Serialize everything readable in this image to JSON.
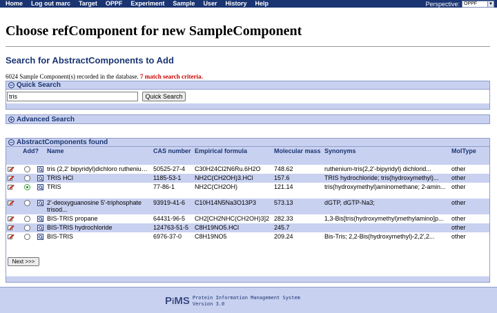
{
  "nav": {
    "items": [
      "Home",
      "Log out marc",
      "Target",
      "OPPF",
      "Experiment",
      "Sample",
      "User",
      "History",
      "Help"
    ],
    "perspective_label": "Perspective:",
    "perspective_value": "OPPF"
  },
  "page_title": "Choose refComponent for new SampleComponent",
  "section_heading": "Search for AbstractComponents to Add",
  "record_count": {
    "text": "6024 Sample Component(s) recorded in the database.",
    "criteria": "7 match search criteria."
  },
  "quick_search": {
    "title": "Quick Search",
    "value": "tris",
    "button_label": "Quick Search"
  },
  "advanced_search": {
    "title": "Advanced Search"
  },
  "results": {
    "title": "AbstractComponents found",
    "columns": [
      "Add?",
      "Name",
      "CAS number",
      "Empirical formula",
      "Molecular mass",
      "Synonyms",
      "MolType"
    ],
    "rows": [
      {
        "name": "tris (2,2' bipyridyl)dichloro ruthenium(...",
        "cas": "50525-27-4",
        "formula": "C30H24Cl2N6Ru.6H2O",
        "mass": "748.62",
        "synonyms": "ruthenium-tris(2,2'-bipyridyl) dichlorid...",
        "moltype": "other",
        "checked": false
      },
      {
        "name": "TRIS HCl",
        "cas": "1185-53-1",
        "formula": "NH2C(CH2OH)3.HCl",
        "mass": "157.6",
        "synonyms": "TRIS hydrochloride; tris(hydroxymethyl)...",
        "moltype": "other",
        "checked": false
      },
      {
        "name": "TRIS",
        "cas": "77-86-1",
        "formula": "NH2C(CH2OH)",
        "mass": "121.14",
        "synonyms": "tris(hydroxymethyl)aminomethane; 2-amin...",
        "moltype": "other",
        "checked": true
      },
      {
        "name": "2'-deoxyguanosine 5'-triphosphate trisod...",
        "cas": "93919-41-6",
        "formula": "C10H14N5Na3O13P3",
        "mass": "573.13",
        "synonyms": "dGTP, dGTP-Na3;",
        "moltype": "other",
        "checked": false
      },
      {
        "name": "BIS-TRIS propane",
        "cas": "64431-96-5",
        "formula": "CH2[CH2NHC(CH2OH)3]2",
        "mass": "282.33",
        "synonyms": "1,3-Bis[tris(hydroxymethyl)methylamino]p...",
        "moltype": "other",
        "checked": false
      },
      {
        "name": "BIS-TRIS hydrochloride",
        "cas": "124763-51-5",
        "formula": "C8H19NO5.HCl",
        "mass": "245.7",
        "synonyms": "",
        "moltype": "other",
        "checked": false
      },
      {
        "name": "BIS-TRIS",
        "cas": "6976-37-0",
        "formula": "C8H19NO5",
        "mass": "209.24",
        "synonyms": "Bis-Tris; 2,2-Bis(hydroxymethyl)-2,2',2...",
        "moltype": "other",
        "checked": false
      }
    ],
    "next_label": "Next >>>"
  },
  "footer": {
    "logo_p": "P",
    "logo_i": "i",
    "logo_ms": "MS",
    "line1": "Protein Information Management System",
    "line2": "Version 3.0"
  }
}
